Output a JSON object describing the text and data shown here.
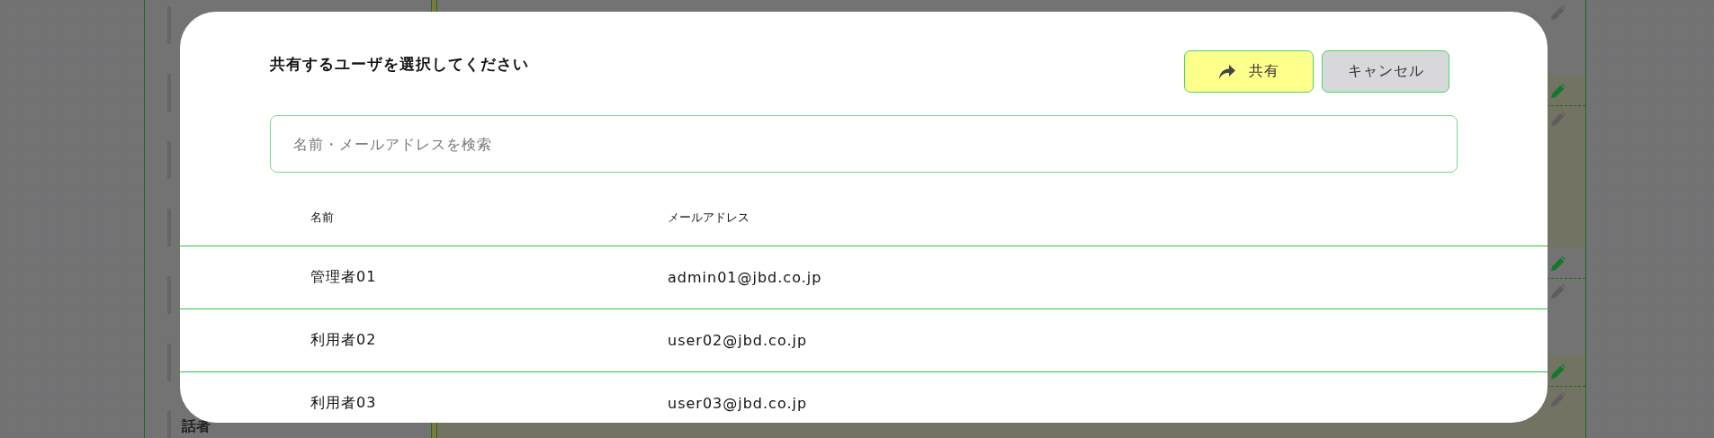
{
  "background": {
    "sidebar_label": "話者",
    "rows": [
      {
        "highlighted": false
      },
      {
        "highlighted": true
      },
      {
        "highlighted": false
      },
      {
        "highlighted": true
      }
    ]
  },
  "dialog": {
    "title": "共有するユーザを選択してください",
    "buttons": [
      {
        "kind": "primary",
        "label": "共有"
      },
      {
        "kind": "secondary",
        "label": "キャンセル"
      }
    ],
    "search": {
      "placeholder": "名前・メールアドレスを検索"
    },
    "table": {
      "columns": [
        "名前",
        "メールアドレス"
      ],
      "rows": [
        {
          "name": "管理者01",
          "email": "admin01@jbd.co.jp"
        },
        {
          "name": "利用者02",
          "email": "user02@jbd.co.jp"
        },
        {
          "name": "利用者03",
          "email": "user03@jbd.co.jp"
        }
      ]
    }
  }
}
